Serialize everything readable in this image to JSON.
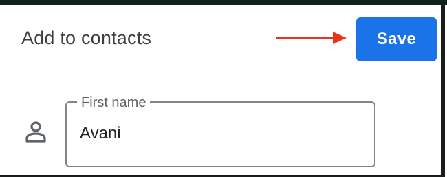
{
  "header": {
    "title": "Add to contacts",
    "save_label": "Save"
  },
  "form": {
    "first_name": {
      "label": "First name",
      "value": "Avani"
    }
  },
  "icons": {
    "field_icon": "person-icon",
    "annotation": "arrow-right-icon"
  },
  "colors": {
    "accent": "#1a73e8",
    "annotation_arrow": "#e8341c",
    "outline": "#80868b"
  }
}
